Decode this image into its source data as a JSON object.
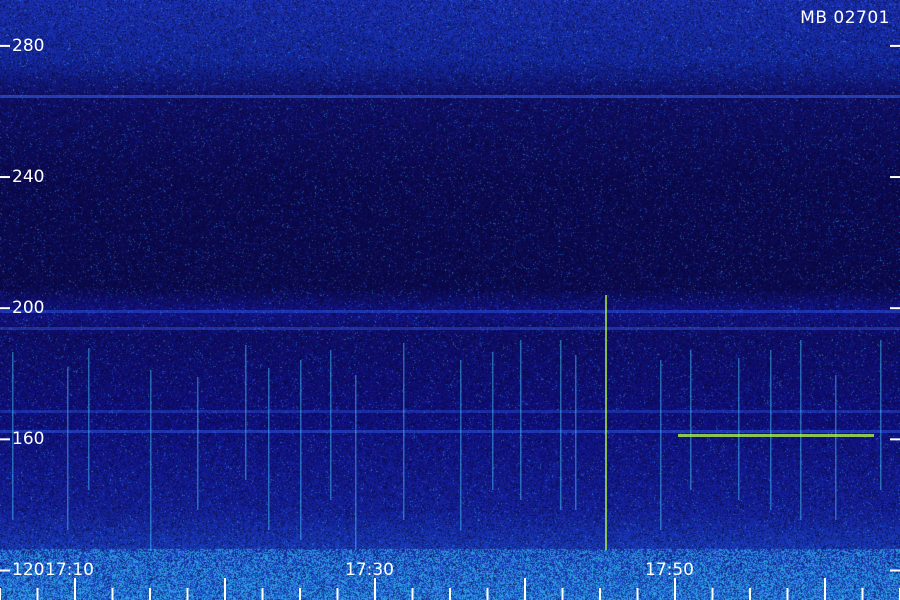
{
  "station_label": "MB 02701",
  "y_axis": {
    "tick_labels": [
      "280",
      "240",
      "200",
      "160",
      "120"
    ],
    "tick_values": [
      280,
      240,
      200,
      160,
      120
    ],
    "range": [
      111,
      294
    ]
  },
  "x_axis": {
    "tick_labels": [
      "17:10",
      "17:30",
      "17:50"
    ],
    "tick_minutes": [
      10,
      30,
      50
    ],
    "range_minutes": [
      5,
      65
    ]
  },
  "colors": {
    "background": "#0a0640",
    "text": "#ffffff",
    "echo": "#4ad0ff",
    "strong_echo": "#b8ff40"
  }
}
